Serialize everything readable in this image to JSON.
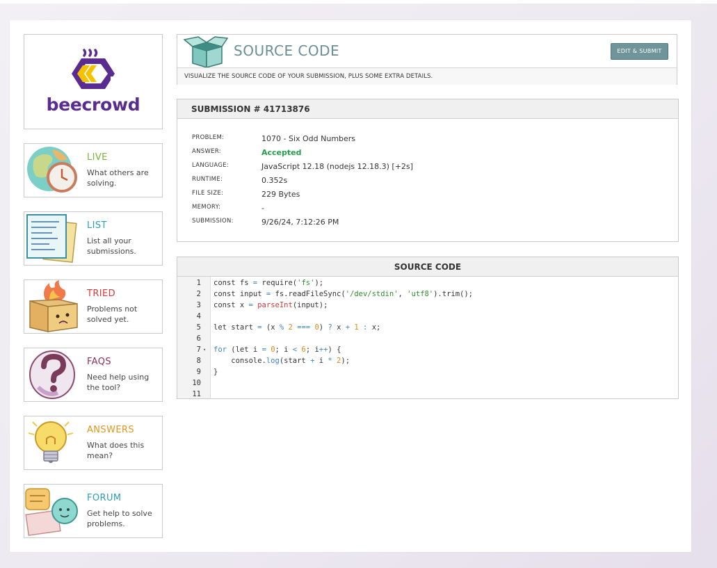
{
  "logo": {
    "text": "beecrowd"
  },
  "menu": [
    {
      "title": "LIVE",
      "desc": "What others are solving.",
      "color": "#7ab23b",
      "icon": "globe-clock-icon"
    },
    {
      "title": "LIST",
      "desc": "List all your submissions.",
      "color": "#2e9bb2",
      "icon": "papers-icon"
    },
    {
      "title": "TRIED",
      "desc": "Problems not solved yet.",
      "color": "#d9383a",
      "icon": "burning-box-icon"
    },
    {
      "title": "FAQS",
      "desc": "Need help using the tool?",
      "color": "#8a2f57",
      "icon": "question-mark-icon"
    },
    {
      "title": "ANSWERS",
      "desc": "What does this mean?",
      "color": "#e0961c",
      "icon": "lightbulb-icon"
    },
    {
      "title": "FORUM",
      "desc": "Get help to solve problems.",
      "color": "#2e9bb2",
      "icon": "chat-bubbles-icon"
    }
  ],
  "header": {
    "title": "SOURCE CODE",
    "subtitle": "VISUALIZE THE SOURCE CODE OF YOUR SUBMISSION, PLUS SOME EXTRA DETAILS.",
    "edit_button": "EDIT & SUBMIT",
    "icon": "open-box-icon"
  },
  "submission": {
    "heading": "SUBMISSION # 41713876",
    "rows": [
      {
        "label": "PROBLEM:",
        "value": "1070 - Six Odd Numbers"
      },
      {
        "label": "ANSWER:",
        "value": "Accepted",
        "status_color": "#23a04b"
      },
      {
        "label": "LANGUAGE:",
        "value": "JavaScript 12.18 (nodejs 12.18.3) [+2s]"
      },
      {
        "label": "RUNTIME:",
        "value": "0.352s"
      },
      {
        "label": "FILE SIZE:",
        "value": "229 Bytes"
      },
      {
        "label": "MEMORY:",
        "value": "-"
      },
      {
        "label": "SUBMISSION:",
        "value": "9/26/24, 7:12:26 PM"
      }
    ]
  },
  "code": {
    "heading": "SOURCE CODE",
    "line_numbers": [
      "1",
      "2",
      "3",
      "4",
      "5",
      "6",
      "7",
      "8",
      "9",
      "10",
      "11"
    ],
    "lines": [
      "const fs = require('fs');",
      "const input = fs.readFileSync('/dev/stdin', 'utf8').trim();",
      "const x = parseInt(input);",
      "",
      "let start = (x % 2 === 0) ? x + 1 : x;",
      "",
      "for (let i = 0; i < 6; i++) {",
      "    console.log(start + i * 2);",
      "}",
      "",
      ""
    ],
    "fold_marker": "▾"
  }
}
